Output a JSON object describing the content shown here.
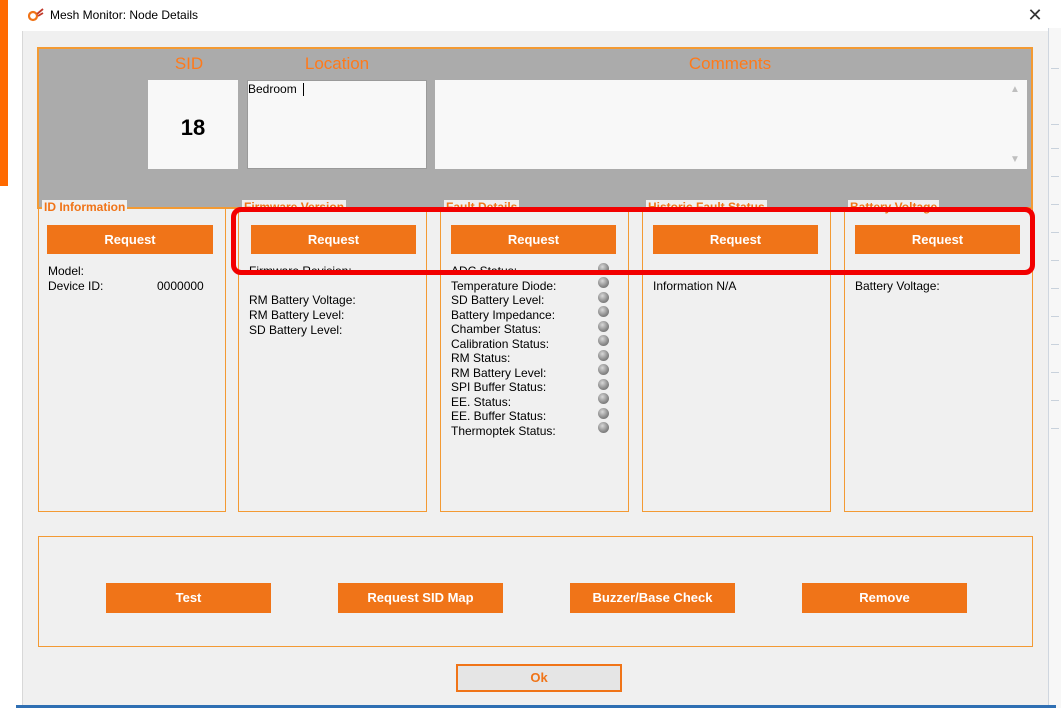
{
  "window": {
    "title": "Mesh Monitor: Node Details",
    "close_symbol": "✕"
  },
  "header": {
    "sid_label": "SID",
    "location_label": "Location",
    "comments_label": "Comments",
    "sid_value": "18",
    "location_value": "Bedroom",
    "comments_value": ""
  },
  "groups": {
    "id_info": {
      "title": "ID Information",
      "request": "Request",
      "model_label": "Model:",
      "device_id_label": "Device ID:",
      "device_id_value": "0000000"
    },
    "group2": {
      "title": "Firmware Version",
      "request": "Request",
      "partial_field": "Firmware Revision:",
      "fields": [
        "RM Battery Voltage:",
        "RM Battery Level:",
        "SD Battery Level:"
      ]
    },
    "group3": {
      "title": "Fault Details",
      "request": "Request",
      "first_status": "ADC Status:",
      "statuses": [
        "Temperature Diode:",
        "SD Battery Level:",
        "Battery Impedance:",
        "Chamber Status:",
        "Calibration Status:",
        "RM Status:",
        "RM Battery Level:",
        "SPI Buffer Status:",
        "EE. Status:",
        "EE. Buffer Status:",
        "Thermoptek Status:"
      ]
    },
    "group4": {
      "title": "Historic Fault Status",
      "request": "Request",
      "info": "Information N/A"
    },
    "group5": {
      "title": "Battery Voltage",
      "request": "Request",
      "battery_label": "Battery Voltage:"
    }
  },
  "actions": {
    "test": "Test",
    "request_sid_map": "Request SID Map",
    "buzzer_base_check": "Buzzer/Base Check",
    "remove": "Remove"
  },
  "ok": "Ok",
  "colors": {
    "accent": "#f07418",
    "highlight": "#f20000",
    "header_bg": "#ababab"
  }
}
